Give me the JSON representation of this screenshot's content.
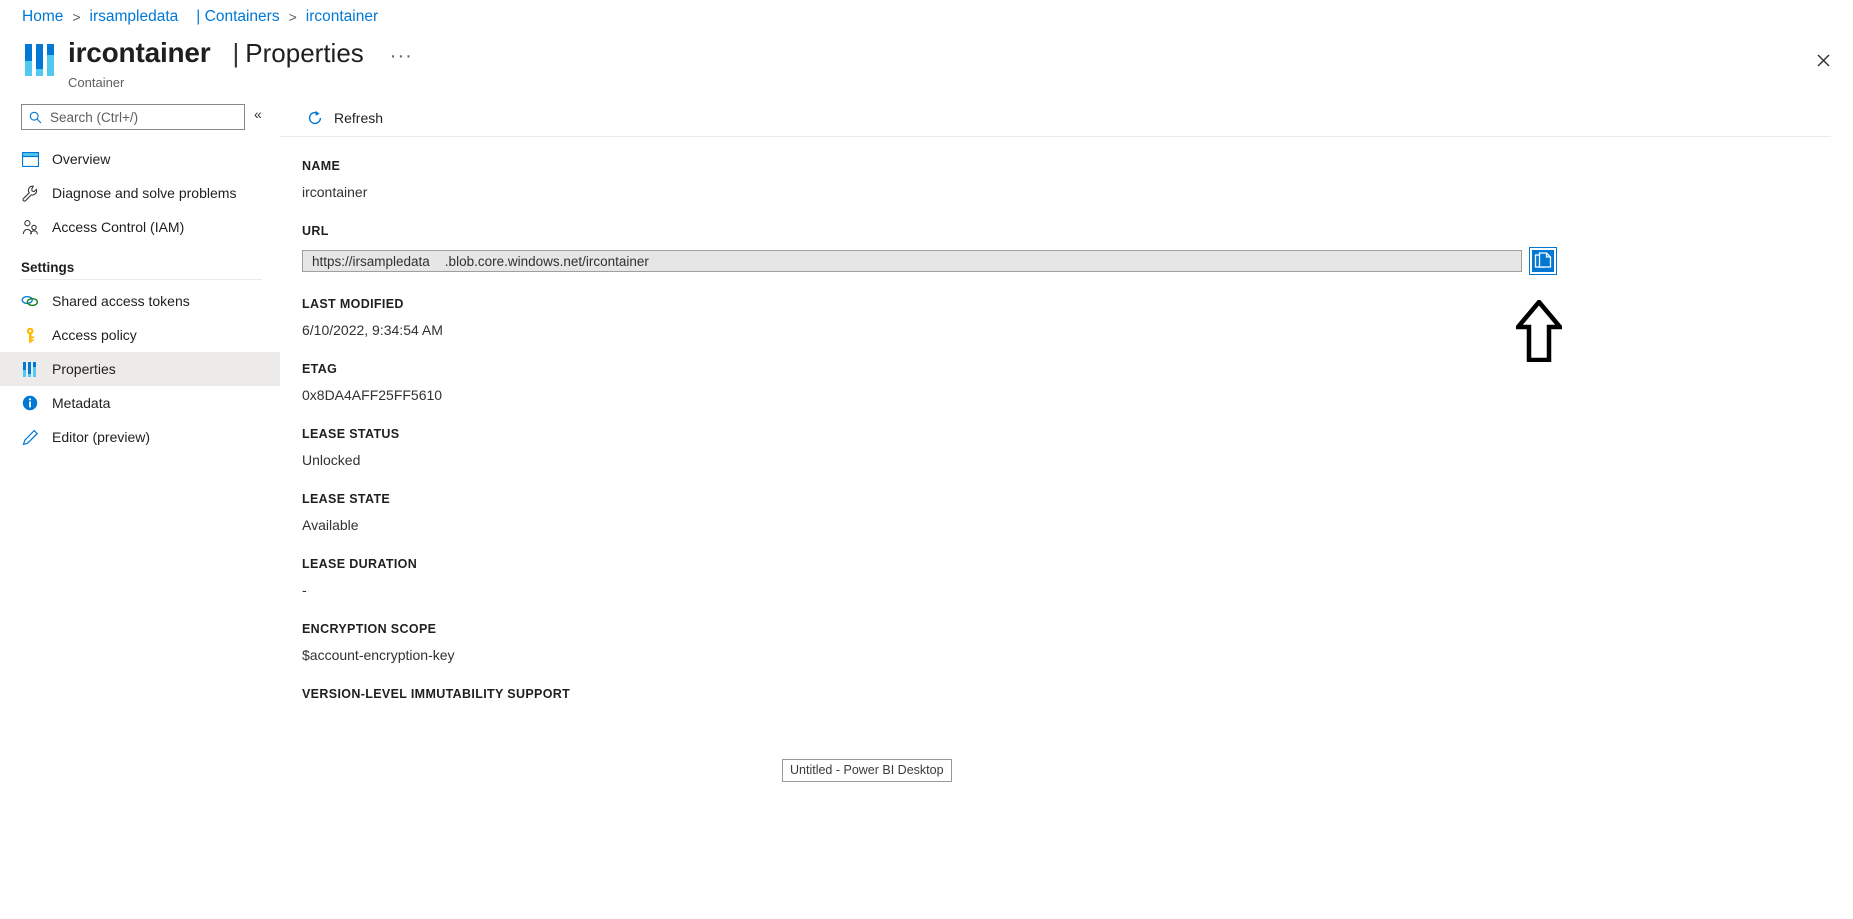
{
  "breadcrumb": [
    {
      "label": "Home",
      "link": true
    },
    {
      "label": "irsampledata",
      "link": true
    },
    {
      "label": "| Containers",
      "link": true
    },
    {
      "label": "ircontainer",
      "link": true
    }
  ],
  "header": {
    "resource_name": "ircontainer",
    "separator": "|",
    "page_title": "Properties",
    "ellipsis": "···",
    "resource_type": "Container",
    "close_label": "✕",
    "icon": "properties-sliders-icon"
  },
  "sidebar": {
    "search": {
      "placeholder": "Search (Ctrl+/)",
      "value": "",
      "icon": "search-icon"
    },
    "collapse_icon": "«",
    "items": [
      {
        "label": "Overview",
        "icon": "overview-icon",
        "selected": false
      },
      {
        "label": "Diagnose and solve problems",
        "icon": "wrench-icon",
        "selected": false
      },
      {
        "label": "Access Control (IAM)",
        "icon": "people-icon",
        "selected": false
      }
    ],
    "group_label": "Settings",
    "settings_items": [
      {
        "label": "Shared access tokens",
        "icon": "link-icon",
        "selected": false
      },
      {
        "label": "Access policy",
        "icon": "key-icon",
        "selected": false
      },
      {
        "label": "Properties",
        "icon": "properties-sliders-icon",
        "selected": true
      },
      {
        "label": "Metadata",
        "icon": "info-icon",
        "selected": false
      },
      {
        "label": "Editor (preview)",
        "icon": "pencil-icon",
        "selected": false
      }
    ]
  },
  "toolbar": {
    "refresh_label": "Refresh",
    "refresh_icon": "refresh-icon"
  },
  "properties": [
    {
      "label": "NAME",
      "value": "ircontainer",
      "type": "text"
    },
    {
      "label": "URL",
      "value": "https://irsampledata    .blob.core.windows.net/ircontainer",
      "type": "field"
    },
    {
      "label": "LAST MODIFIED",
      "value": "6/10/2022, 9:34:54 AM",
      "type": "text"
    },
    {
      "label": "ETAG",
      "value": "0x8DA4AFF25FF5610",
      "type": "text"
    },
    {
      "label": "LEASE STATUS",
      "value": "Unlocked",
      "type": "text"
    },
    {
      "label": "LEASE STATE",
      "value": "Available",
      "type": "text"
    },
    {
      "label": "LEASE DURATION",
      "value": "-",
      "type": "text"
    },
    {
      "label": "ENCRYPTION SCOPE",
      "value": "$account-encryption-key",
      "type": "text"
    },
    {
      "label": "VERSION-LEVEL IMMUTABILITY SUPPORT",
      "value": "",
      "type": "text"
    }
  ],
  "copy_button": {
    "name": "copy-to-clipboard-button",
    "icon": "copy-icon",
    "focused": true
  },
  "annotation": {
    "arrow_icon": "up-arrow-annotation",
    "color": "#000000"
  },
  "taskbar_tooltip": {
    "label": "Untitled - Power BI Desktop"
  },
  "colors": {
    "accent": "#0078d4",
    "selected_bg": "#edebe9",
    "field_bg": "#e6e6e6",
    "border": "#a19f9d",
    "text": "#201f1e",
    "muted": "#605e5c"
  }
}
